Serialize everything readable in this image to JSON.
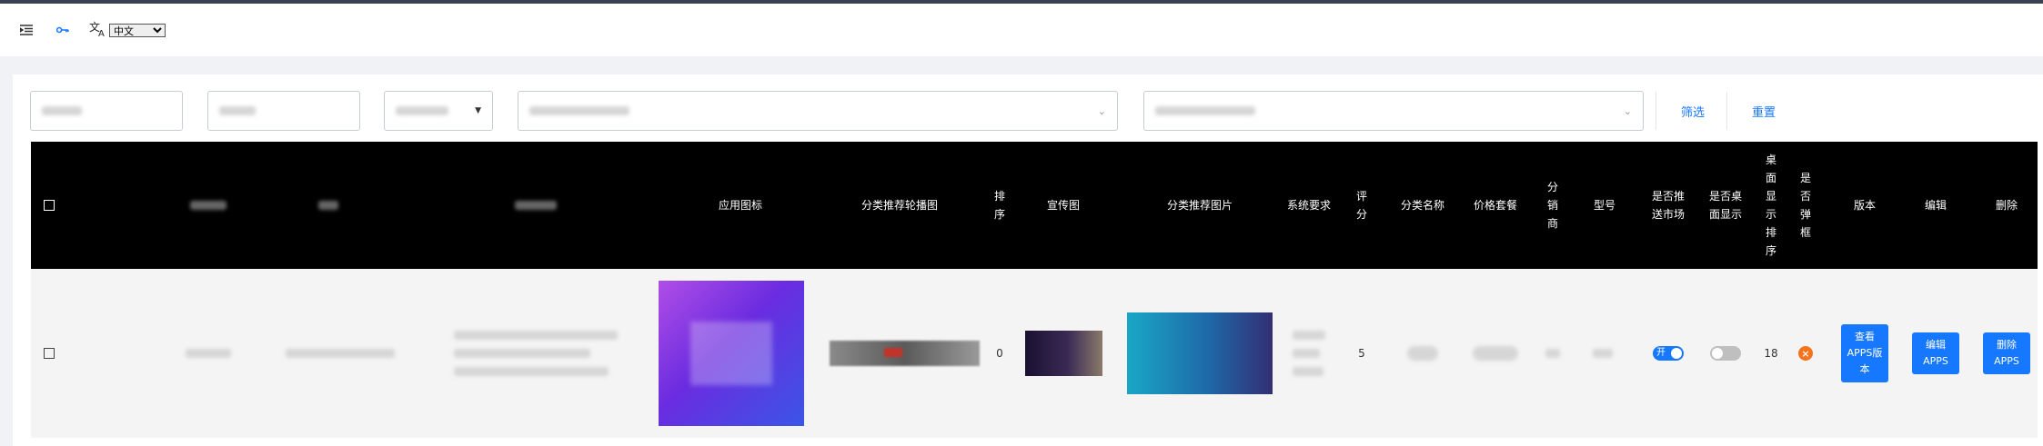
{
  "header": {
    "language_value": "中文",
    "language_options": [
      "中文"
    ]
  },
  "filters": {
    "filter_label": "筛选",
    "reset_label": "重置"
  },
  "table": {
    "columns": {
      "app_icon": "应用图标",
      "category_carousel": "分类推荐轮播图",
      "sort": "排序",
      "promo": "宣传图",
      "category_image": "分类推荐图片",
      "system_req": "系统要求",
      "rating": "评分",
      "category_name": "分类名称",
      "price_plan": "价格套餐",
      "distributor": "分销商",
      "model": "型号",
      "push_market": "是否推送市场",
      "desktop_show": "是否桌面显示",
      "desktop_sort": "桌面显示排序",
      "popup": "是否弹框",
      "version": "版本",
      "edit": "编辑",
      "delete": "删除"
    },
    "rows": [
      {
        "sort": "0",
        "rating": "5",
        "push_market_label": "开",
        "push_market": true,
        "desktop_show": false,
        "desktop_sort": "18",
        "popup": "×",
        "view_versions_label": "查看APPS版本",
        "edit_label": "编辑APPS",
        "delete_label": "删除APPS"
      }
    ]
  },
  "colors": {
    "accent": "#1677ff",
    "header_bg": "#000000",
    "row_bg": "#f4f4f4",
    "danger": "#f5731d"
  }
}
